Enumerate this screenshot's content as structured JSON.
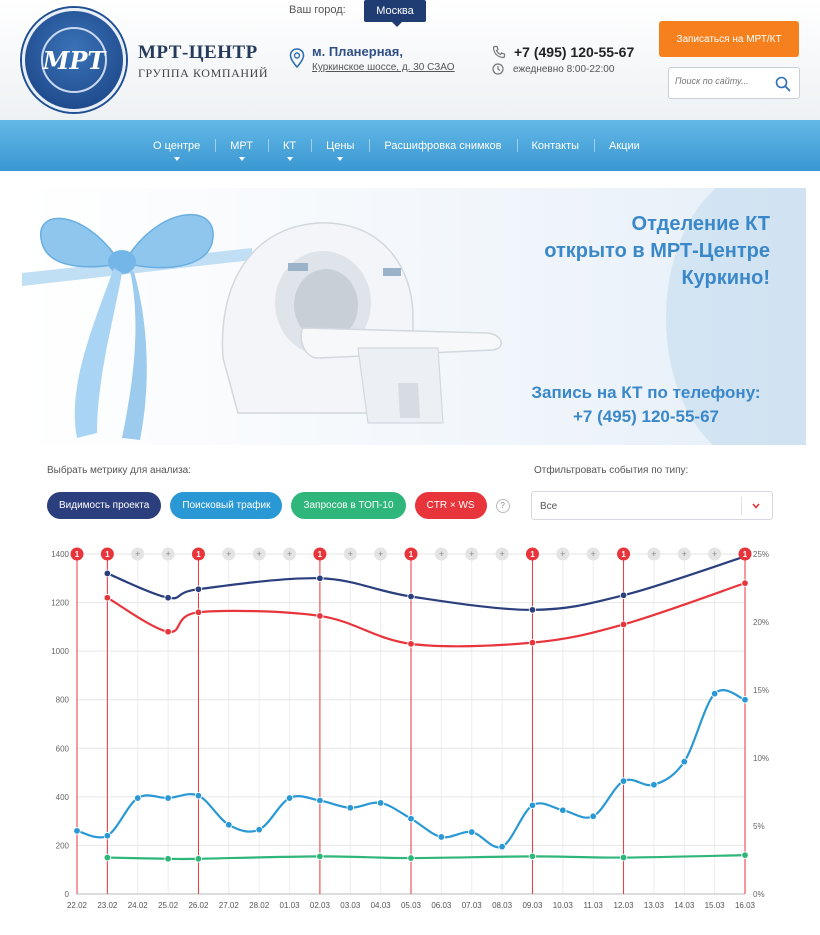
{
  "header": {
    "logo_text": "МРТ",
    "brand_title": "МРТ-ЦЕНТР",
    "brand_subtitle": "ГРУППА КОМПАНИЙ",
    "city_label": "Ваш город:",
    "city": "Москва",
    "metro": "м. Планерная,",
    "address": "Куркинское шоссе, д. 30 СЗАО",
    "phone": "+7 (495) 120-55-67",
    "hours": "ежедневно 8:00-22:00",
    "cta": "Записаться на МРТ/КТ",
    "search_placeholder": "Поиск по сайту...",
    "accent": "#f7801e",
    "brand_color": "#1f3d72"
  },
  "nav": {
    "items": [
      {
        "label": "О центре",
        "dropdown": true
      },
      {
        "label": "МРТ",
        "dropdown": true
      },
      {
        "label": "КТ",
        "dropdown": true
      },
      {
        "label": "Цены",
        "dropdown": true
      },
      {
        "label": "Расшифровка снимков",
        "dropdown": false
      },
      {
        "label": "Контакты",
        "dropdown": false
      },
      {
        "label": "Акции",
        "dropdown": false
      }
    ]
  },
  "banner": {
    "title": "Отделение КТ\nоткрыто в МРТ-Центре\nКуркино!",
    "sub_line1": "Запись на КТ по телефону:",
    "sub_line2": "+7 (495) 120-55-67"
  },
  "analytics": {
    "metric_label": "Выбрать метрику для анализа:",
    "filter_label": "Отфильтровать события по типу:",
    "filter_value": "Все",
    "help": "?",
    "metrics": [
      {
        "label": "Видимость проекта",
        "color": "#2b3f7e"
      },
      {
        "label": "Поисковый трафик",
        "color": "#2a98d4"
      },
      {
        "label": "Запросов в ТОП-10",
        "color": "#2fb67a"
      },
      {
        "label": "CTR × WS",
        "color": "#e8353c"
      }
    ]
  },
  "chart_data": {
    "type": "line",
    "x": [
      "22.02",
      "23.02",
      "24.02",
      "25.02",
      "26.02",
      "27.02",
      "28.02",
      "01.03",
      "02.03",
      "03.03",
      "04.03",
      "05.03",
      "06.03",
      "07.03",
      "08.03",
      "09.03",
      "10.03",
      "11.03",
      "12.03",
      "13.03",
      "14.03",
      "15.03",
      "16.03"
    ],
    "y_left_ticks": [
      "0",
      "200",
      "400",
      "600",
      "800",
      "1000",
      "1200",
      "1400"
    ],
    "y_left_lim": [
      0,
      1400
    ],
    "y_right_ticks": [
      "0%",
      "5%",
      "10%",
      "15%",
      "20%",
      "25%"
    ],
    "y_right_lim": [
      0,
      25
    ],
    "grid": true,
    "event_markers": [
      {
        "x": "22.02",
        "label": "1",
        "type": "event"
      },
      {
        "x": "23.02",
        "label": "1",
        "type": "event"
      },
      {
        "x": "24.02",
        "label": "+",
        "type": "add"
      },
      {
        "x": "25.02",
        "label": "+",
        "type": "add"
      },
      {
        "x": "26.02",
        "label": "1",
        "type": "event"
      },
      {
        "x": "27.02",
        "label": "+",
        "type": "add"
      },
      {
        "x": "28.02",
        "label": "+",
        "type": "add"
      },
      {
        "x": "01.03",
        "label": "+",
        "type": "add"
      },
      {
        "x": "02.03",
        "label": "1",
        "type": "event"
      },
      {
        "x": "03.03",
        "label": "+",
        "type": "add"
      },
      {
        "x": "04.03",
        "label": "+",
        "type": "add"
      },
      {
        "x": "05.03",
        "label": "1",
        "type": "event"
      },
      {
        "x": "06.03",
        "label": "+",
        "type": "add"
      },
      {
        "x": "07.03",
        "label": "+",
        "type": "add"
      },
      {
        "x": "08.03",
        "label": "+",
        "type": "add"
      },
      {
        "x": "09.03",
        "label": "1",
        "type": "event"
      },
      {
        "x": "10.03",
        "label": "+",
        "type": "add"
      },
      {
        "x": "11.03",
        "label": "+",
        "type": "add"
      },
      {
        "x": "12.03",
        "label": "1",
        "type": "event"
      },
      {
        "x": "13.03",
        "label": "+",
        "type": "add"
      },
      {
        "x": "14.03",
        "label": "+",
        "type": "add"
      },
      {
        "x": "15.03",
        "label": "+",
        "type": "add"
      },
      {
        "x": "16.03",
        "label": "1",
        "type": "event"
      }
    ],
    "series": [
      {
        "color": "#2b3f7e",
        "axis": "left",
        "points": [
          [
            "23.02",
            1320
          ],
          [
            "25.02",
            1220
          ],
          [
            "26.02",
            1255
          ],
          [
            "02.03",
            1300
          ],
          [
            "05.03",
            1225
          ],
          [
            "09.03",
            1170
          ],
          [
            "12.03",
            1230
          ],
          [
            "16.03",
            1390
          ]
        ]
      },
      {
        "color": "#e8353c",
        "axis": "left",
        "points": [
          [
            "23.02",
            1220
          ],
          [
            "25.02",
            1080
          ],
          [
            "26.02",
            1160
          ],
          [
            "02.03",
            1145
          ],
          [
            "05.03",
            1030
          ],
          [
            "09.03",
            1035
          ],
          [
            "12.03",
            1110
          ],
          [
            "16.03",
            1280
          ]
        ]
      },
      {
        "color": "#2a98d4",
        "axis": "left",
        "points": [
          [
            "22.02",
            260
          ],
          [
            "23.02",
            240
          ],
          [
            "24.02",
            395
          ],
          [
            "25.02",
            395
          ],
          [
            "26.02",
            405
          ],
          [
            "27.02",
            285
          ],
          [
            "28.02",
            265
          ],
          [
            "01.03",
            395
          ],
          [
            "02.03",
            385
          ],
          [
            "03.03",
            355
          ],
          [
            "04.03",
            375
          ],
          [
            "05.03",
            310
          ],
          [
            "06.03",
            235
          ],
          [
            "07.03",
            255
          ],
          [
            "08.03",
            195
          ],
          [
            "09.03",
            365
          ],
          [
            "10.03",
            345
          ],
          [
            "11.03",
            320
          ],
          [
            "12.03",
            465
          ],
          [
            "13.03",
            450
          ],
          [
            "14.03",
            545
          ],
          [
            "15.03",
            825
          ],
          [
            "16.03",
            800
          ]
        ]
      },
      {
        "color": "#2fb67a",
        "axis": "left",
        "points": [
          [
            "23.02",
            150
          ],
          [
            "25.02",
            145
          ],
          [
            "26.02",
            145
          ],
          [
            "02.03",
            155
          ],
          [
            "05.03",
            148
          ],
          [
            "09.03",
            155
          ],
          [
            "12.03",
            150
          ],
          [
            "16.03",
            160
          ]
        ]
      }
    ]
  }
}
